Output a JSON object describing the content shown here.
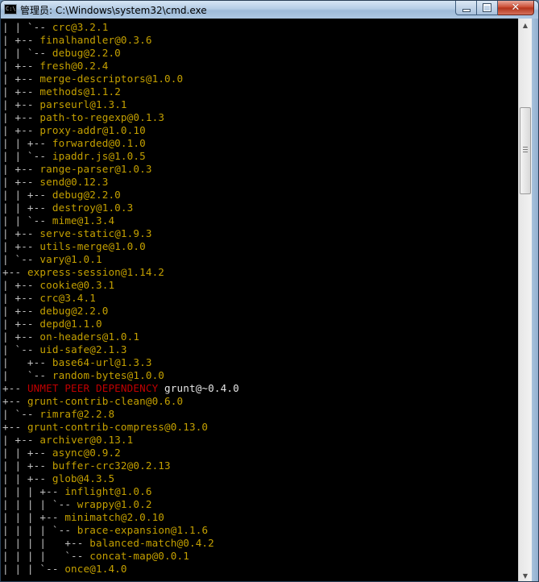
{
  "window": {
    "icon_text": "C:\\",
    "title": "管理员: C:\\Windows\\system32\\cmd.exe"
  },
  "console": {
    "lines": [
      {
        "tree": "| | `-- ",
        "pkg": "crc@3.2.1"
      },
      {
        "tree": "| +-- ",
        "pkg": "finalhandler@0.3.6"
      },
      {
        "tree": "| | `-- ",
        "pkg": "debug@2.2.0"
      },
      {
        "tree": "| +-- ",
        "pkg": "fresh@0.2.4"
      },
      {
        "tree": "| +-- ",
        "pkg": "merge-descriptors@1.0.0"
      },
      {
        "tree": "| +-- ",
        "pkg": "methods@1.1.2"
      },
      {
        "tree": "| +-- ",
        "pkg": "parseurl@1.3.1"
      },
      {
        "tree": "| +-- ",
        "pkg": "path-to-regexp@0.1.3"
      },
      {
        "tree": "| +-- ",
        "pkg": "proxy-addr@1.0.10"
      },
      {
        "tree": "| | +-- ",
        "pkg": "forwarded@0.1.0"
      },
      {
        "tree": "| | `-- ",
        "pkg": "ipaddr.js@1.0.5"
      },
      {
        "tree": "| +-- ",
        "pkg": "range-parser@1.0.3"
      },
      {
        "tree": "| +-- ",
        "pkg": "send@0.12.3"
      },
      {
        "tree": "| | +-- ",
        "pkg": "debug@2.2.0"
      },
      {
        "tree": "| | +-- ",
        "pkg": "destroy@1.0.3"
      },
      {
        "tree": "| | `-- ",
        "pkg": "mime@1.3.4"
      },
      {
        "tree": "| +-- ",
        "pkg": "serve-static@1.9.3"
      },
      {
        "tree": "| +-- ",
        "pkg": "utils-merge@1.0.0"
      },
      {
        "tree": "| `-- ",
        "pkg": "vary@1.0.1"
      },
      {
        "tree": "+-- ",
        "pkg": "express-session@1.14.2"
      },
      {
        "tree": "| +-- ",
        "pkg": "cookie@0.3.1"
      },
      {
        "tree": "| +-- ",
        "pkg": "crc@3.4.1"
      },
      {
        "tree": "| +-- ",
        "pkg": "debug@2.2.0"
      },
      {
        "tree": "| +-- ",
        "pkg": "depd@1.1.0"
      },
      {
        "tree": "| +-- ",
        "pkg": "on-headers@1.0.1"
      },
      {
        "tree": "| `-- ",
        "pkg": "uid-safe@2.1.3"
      },
      {
        "tree": "|   +-- ",
        "pkg": "base64-url@1.3.3"
      },
      {
        "tree": "|   `-- ",
        "pkg": "random-bytes@1.0.0"
      },
      {
        "tree": "+-- ",
        "warn": "UNMET PEER DEPENDENCY",
        "white": " grunt@~0.4.0"
      },
      {
        "tree": "+-- ",
        "pkg": "grunt-contrib-clean@0.6.0"
      },
      {
        "tree": "| `-- ",
        "pkg": "rimraf@2.2.8"
      },
      {
        "tree": "+-- ",
        "pkg": "grunt-contrib-compress@0.13.0"
      },
      {
        "tree": "| +-- ",
        "pkg": "archiver@0.13.1"
      },
      {
        "tree": "| | +-- ",
        "pkg": "async@0.9.2"
      },
      {
        "tree": "| | +-- ",
        "pkg": "buffer-crc32@0.2.13"
      },
      {
        "tree": "| | +-- ",
        "pkg": "glob@4.3.5"
      },
      {
        "tree": "| | | +-- ",
        "pkg": "inflight@1.0.6"
      },
      {
        "tree": "| | | | `-- ",
        "pkg": "wrappy@1.0.2"
      },
      {
        "tree": "| | | +-- ",
        "pkg": "minimatch@2.0.10"
      },
      {
        "tree": "| | | | `-- ",
        "pkg": "brace-expansion@1.1.6"
      },
      {
        "tree": "| | | |   +-- ",
        "pkg": "balanced-match@0.4.2"
      },
      {
        "tree": "| | | |   `-- ",
        "pkg": "concat-map@0.0.1"
      },
      {
        "tree": "| | | `-- ",
        "pkg": "once@1.4.0"
      }
    ]
  },
  "colors": {
    "console_bg": "#000000",
    "tree_text": "#c0c0c0",
    "package_text": "#c4a000",
    "warning_text": "#c00000"
  }
}
